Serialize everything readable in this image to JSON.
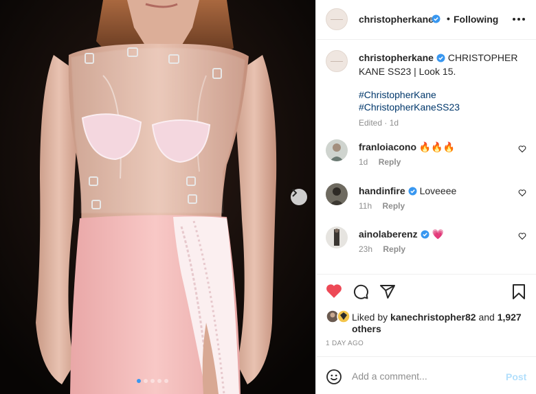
{
  "post": {
    "username": "christopherkane",
    "follow_status": "Following",
    "separator": "•",
    "caption": {
      "username": "christopherkane",
      "text": "CHRISTOPHER KANE SS23 | Look 15.",
      "hashtags": [
        "#ChristopherKane",
        "#ChristopherKaneSS23"
      ],
      "meta": "Edited · 1d"
    },
    "comments": [
      {
        "username": "franloiacono",
        "text": "🔥🔥🔥",
        "verified": false,
        "age": "1d",
        "reply": "Reply"
      },
      {
        "username": "handinfire",
        "text": "Loveeee",
        "verified": true,
        "age": "11h",
        "reply": "Reply"
      },
      {
        "username": "ainolaberenz",
        "text": "💗",
        "verified": true,
        "age": "23h",
        "reply": "Reply"
      }
    ],
    "likes": {
      "prefix": "Liked by",
      "user": "kanechristopher82",
      "and": "and",
      "others": "1,927 others"
    },
    "timestamp": "1 DAY AGO",
    "add_comment": {
      "placeholder": "Add a comment...",
      "post_label": "Post"
    },
    "carousel": {
      "count": 5,
      "active": 1
    }
  },
  "colors": {
    "accent_blue": "#0095f6",
    "verified_blue": "#3897f0",
    "like_red": "#ed4956",
    "hashtag": "#00376b",
    "muted": "#8e8e8e"
  },
  "icons": [
    "chevron-right-icon",
    "verified-icon",
    "more-icon",
    "heart-icon",
    "comment-icon",
    "share-icon",
    "save-icon",
    "emoji-icon"
  ]
}
